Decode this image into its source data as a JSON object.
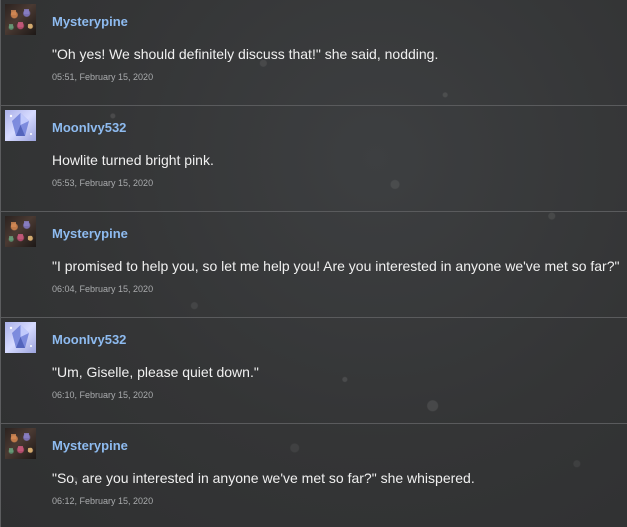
{
  "posts": [
    {
      "username": "Mysterypine",
      "avatar_icon": "mysterypine-avatar",
      "message": "\"Oh yes! We should definitely discuss that!\" she said, nodding.",
      "timestamp": "05:51, February 15, 2020"
    },
    {
      "username": "MoonIvy532",
      "avatar_icon": "moonivy-avatar",
      "message": "Howlite turned bright pink.",
      "timestamp": "05:53, February 15, 2020"
    },
    {
      "username": "Mysterypine",
      "avatar_icon": "mysterypine-avatar",
      "message": "\"I promised to help you, so let me help you! Are you interested in anyone we've met so far?\"",
      "timestamp": "06:04, February 15, 2020"
    },
    {
      "username": "MoonIvy532",
      "avatar_icon": "moonivy-avatar",
      "message": "\"Um, Giselle, please quiet down.\"",
      "timestamp": "06:10, February 15, 2020"
    },
    {
      "username": "Mysterypine",
      "avatar_icon": "mysterypine-avatar",
      "message": "\"So, are you interested in anyone we've met so far?\" she whispered.",
      "timestamp": "06:12, February 15, 2020"
    }
  ],
  "colors": {
    "background": "#353637",
    "username": "#8ebbf0",
    "message_text": "#f0f0f0",
    "timestamp_text": "#a9abad",
    "divider": "#5a5b5d"
  }
}
